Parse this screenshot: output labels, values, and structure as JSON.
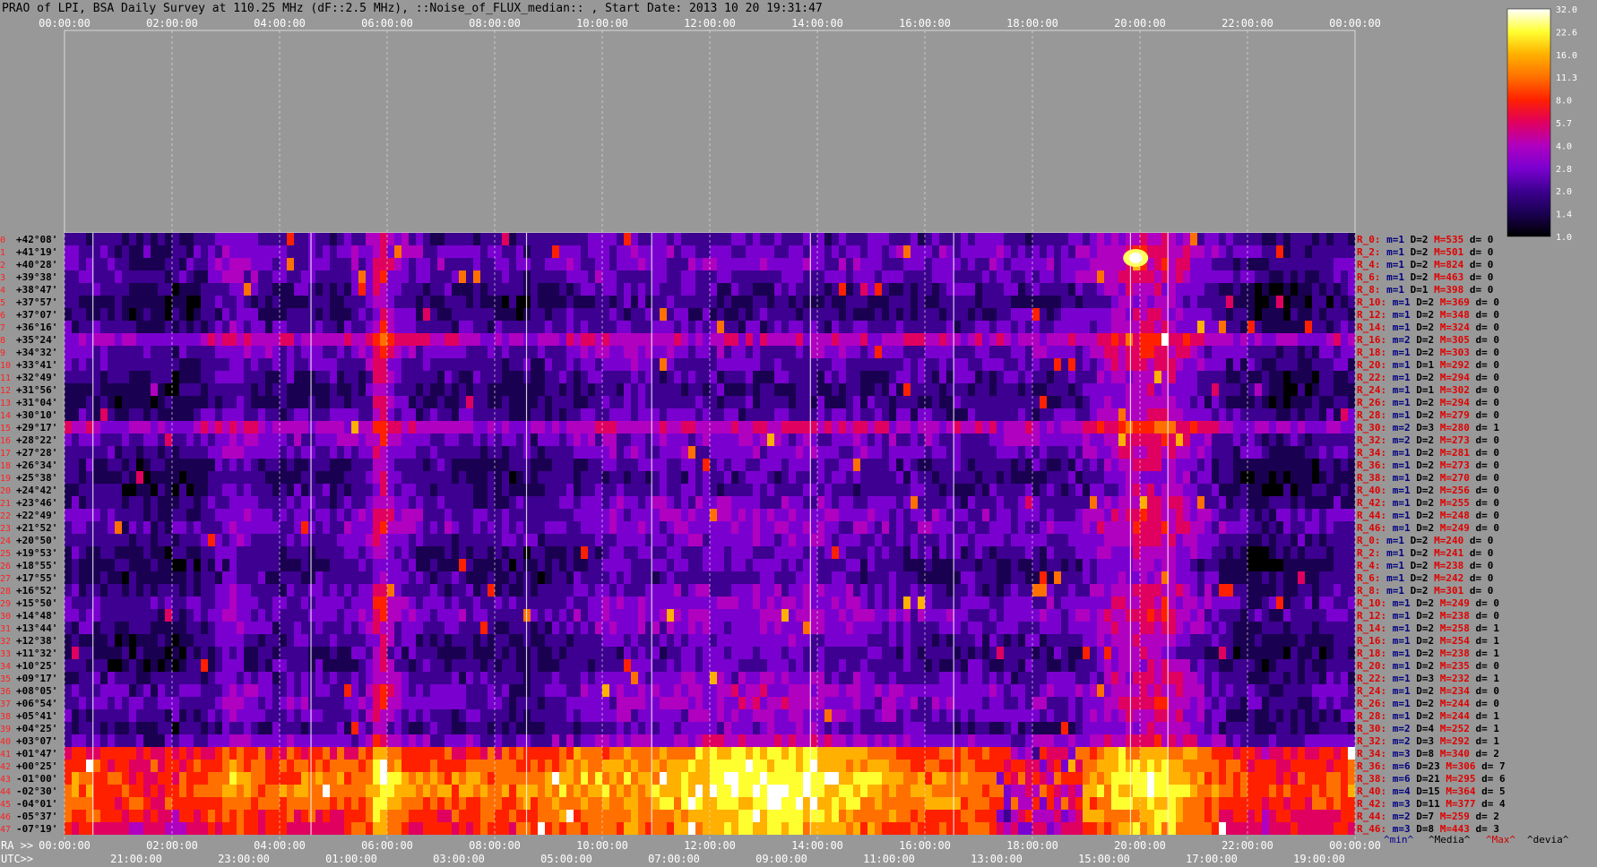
{
  "header": {
    "title": "PRAO of LPI, BSA Daily Survey at 110.25 MHz (dF::2.5 MHz), ::Noise_of_FLUX_median:: , Start Date: 2013 10 20 19:31:47"
  },
  "axes": {
    "top_ticks": [
      "00:00:00",
      "02:00:00",
      "04:00:00",
      "06:00:00",
      "08:00:00",
      "10:00:00",
      "12:00:00",
      "14:00:00",
      "16:00:00",
      "18:00:00",
      "20:00:00",
      "22:00:00",
      "00:00:00"
    ],
    "ra_prefix": "RA >>",
    "ra_ticks": [
      "00:00:00",
      "02:00:00",
      "04:00:00",
      "06:00:00",
      "08:00:00",
      "10:00:00",
      "12:00:00",
      "14:00:00",
      "16:00:00",
      "18:00:00",
      "20:00:00",
      "22:00:00",
      "00:00:00"
    ],
    "utc_prefix": "UTC>>",
    "utc_ticks": [
      "21:00:00",
      "23:00:00",
      "01:00:00",
      "03:00:00",
      "05:00:00",
      "07:00:00",
      "09:00:00",
      "11:00:00",
      "13:00:00",
      "15:00:00",
      "17:00:00",
      "19:00:00"
    ]
  },
  "colorbar": {
    "ticks": [
      "32.0",
      "22.6",
      "16.0",
      "11.3",
      "8.0",
      "5.7",
      "4.0",
      "2.8",
      "2.0",
      "1.4",
      "1.0"
    ],
    "colors": [
      "#000000",
      "#1a0050",
      "#3d0090",
      "#7a00d0",
      "#b000c0",
      "#e00060",
      "#ff2000",
      "#ff7000",
      "#ffb000",
      "#ffff30",
      "#ffffff"
    ]
  },
  "declinations": [
    "+42°08'",
    "+41°19'",
    "+40°28'",
    "+39°38'",
    "+38°47'",
    "+37°57'",
    "+37°07'",
    "+36°16'",
    "+35°24'",
    "+34°32'",
    "+33°41'",
    "+32°49'",
    "+31°56'",
    "+31°04'",
    "+30°10'",
    "+29°17'",
    "+28°22'",
    "+27°28'",
    "+26°34'",
    "+25°38'",
    "+24°42'",
    "+23°46'",
    "+22°49'",
    "+21°52'",
    "+20°50'",
    "+19°53'",
    "+18°55'",
    "+17°55'",
    "+16°52'",
    "+15°50'",
    "+14°48'",
    "+13°44'",
    "+12°38'",
    "+11°32'",
    "+10°25'",
    "+09°17'",
    "+08°05'",
    "+06°54'",
    "+05°41'",
    "+04°25'",
    "+03°07'",
    "+01°47'",
    "+00°25'",
    "-01°00'",
    "-02°30'",
    "-04°01'",
    "-05°37'",
    "-07°19'"
  ],
  "row_stats": [
    {
      "r": "R_0:",
      "m": "m=1",
      "d": "D=2",
      "M": "M=535",
      "dev": "d= 0"
    },
    {
      "r": "R_2:",
      "m": "m=1",
      "d": "D=2",
      "M": "M=501",
      "dev": "d= 0"
    },
    {
      "r": "R_4:",
      "m": "m=1",
      "d": "D=2",
      "M": "M=824",
      "dev": "d= 0"
    },
    {
      "r": "R_6:",
      "m": "m=1",
      "d": "D=2",
      "M": "M=463",
      "dev": "d= 0"
    },
    {
      "r": "R_8:",
      "m": "m=1",
      "d": "D=1",
      "M": "M=398",
      "dev": "d= 0"
    },
    {
      "r": "R_10:",
      "m": "m=1",
      "d": "D=2",
      "M": "M=369",
      "dev": "d= 0"
    },
    {
      "r": "R_12:",
      "m": "m=1",
      "d": "D=2",
      "M": "M=348",
      "dev": "d= 0"
    },
    {
      "r": "R_14:",
      "m": "m=1",
      "d": "D=2",
      "M": "M=324",
      "dev": "d= 0"
    },
    {
      "r": "R_16:",
      "m": "m=2",
      "d": "D=2",
      "M": "M=305",
      "dev": "d= 0"
    },
    {
      "r": "R_18:",
      "m": "m=1",
      "d": "D=2",
      "M": "M=303",
      "dev": "d= 0"
    },
    {
      "r": "R_20:",
      "m": "m=1",
      "d": "D=1",
      "M": "M=292",
      "dev": "d= 0"
    },
    {
      "r": "R_22:",
      "m": "m=1",
      "d": "D=2",
      "M": "M=294",
      "dev": "d= 0"
    },
    {
      "r": "R_24:",
      "m": "m=1",
      "d": "D=1",
      "M": "M=302",
      "dev": "d= 0"
    },
    {
      "r": "R_26:",
      "m": "m=1",
      "d": "D=2",
      "M": "M=294",
      "dev": "d= 0"
    },
    {
      "r": "R_28:",
      "m": "m=1",
      "d": "D=2",
      "M": "M=279",
      "dev": "d= 0"
    },
    {
      "r": "R_30:",
      "m": "m=2",
      "d": "D=3",
      "M": "M=280",
      "dev": "d= 1"
    },
    {
      "r": "R_32:",
      "m": "m=2",
      "d": "D=2",
      "M": "M=273",
      "dev": "d= 0"
    },
    {
      "r": "R_34:",
      "m": "m=1",
      "d": "D=2",
      "M": "M=281",
      "dev": "d= 0"
    },
    {
      "r": "R_36:",
      "m": "m=1",
      "d": "D=2",
      "M": "M=273",
      "dev": "d= 0"
    },
    {
      "r": "R_38:",
      "m": "m=1",
      "d": "D=2",
      "M": "M=270",
      "dev": "d= 0"
    },
    {
      "r": "R_40:",
      "m": "m=1",
      "d": "D=2",
      "M": "M=256",
      "dev": "d= 0"
    },
    {
      "r": "R_42:",
      "m": "m=1",
      "d": "D=2",
      "M": "M=255",
      "dev": "d= 0"
    },
    {
      "r": "R_44:",
      "m": "m=1",
      "d": "D=2",
      "M": "M=248",
      "dev": "d= 0"
    },
    {
      "r": "R_46:",
      "m": "m=1",
      "d": "D=2",
      "M": "M=249",
      "dev": "d= 0"
    },
    {
      "r": "R_0:",
      "m": "m=1",
      "d": "D=2",
      "M": "M=240",
      "dev": "d= 0"
    },
    {
      "r": "R_2:",
      "m": "m=1",
      "d": "D=2",
      "M": "M=241",
      "dev": "d= 0"
    },
    {
      "r": "R_4:",
      "m": "m=1",
      "d": "D=2",
      "M": "M=238",
      "dev": "d= 0"
    },
    {
      "r": "R_6:",
      "m": "m=1",
      "d": "D=2",
      "M": "M=242",
      "dev": "d= 0"
    },
    {
      "r": "R_8:",
      "m": "m=1",
      "d": "D=2",
      "M": "M=301",
      "dev": "d= 0"
    },
    {
      "r": "R_10:",
      "m": "m=1",
      "d": "D=2",
      "M": "M=249",
      "dev": "d= 0"
    },
    {
      "r": "R_12:",
      "m": "m=1",
      "d": "D=2",
      "M": "M=238",
      "dev": "d= 0"
    },
    {
      "r": "R_14:",
      "m": "m=1",
      "d": "D=2",
      "M": "M=258",
      "dev": "d= 1"
    },
    {
      "r": "R_16:",
      "m": "m=1",
      "d": "D=2",
      "M": "M=254",
      "dev": "d= 1"
    },
    {
      "r": "R_18:",
      "m": "m=1",
      "d": "D=2",
      "M": "M=238",
      "dev": "d= 1"
    },
    {
      "r": "R_20:",
      "m": "m=1",
      "d": "D=2",
      "M": "M=235",
      "dev": "d= 0"
    },
    {
      "r": "R_22:",
      "m": "m=1",
      "d": "D=3",
      "M": "M=232",
      "dev": "d= 1"
    },
    {
      "r": "R_24:",
      "m": "m=1",
      "d": "D=2",
      "M": "M=234",
      "dev": "d= 0"
    },
    {
      "r": "R_26:",
      "m": "m=1",
      "d": "D=2",
      "M": "M=244",
      "dev": "d= 0"
    },
    {
      "r": "R_28:",
      "m": "m=1",
      "d": "D=2",
      "M": "M=244",
      "dev": "d= 1"
    },
    {
      "r": "R_30:",
      "m": "m=2",
      "d": "D=4",
      "M": "M=252",
      "dev": "d= 1"
    },
    {
      "r": "R_32:",
      "m": "m=2",
      "d": "D=3",
      "M": "M=292",
      "dev": "d= 1"
    },
    {
      "r": "R_34:",
      "m": "m=3",
      "d": "D=8",
      "M": "M=340",
      "dev": "d= 2"
    },
    {
      "r": "R_36:",
      "m": "m=6",
      "d": "D=23",
      "M": "M=306",
      "dev": "d= 7"
    },
    {
      "r": "R_38:",
      "m": "m=6",
      "d": "D=21",
      "M": "M=295",
      "dev": "d= 6"
    },
    {
      "r": "R_40:",
      "m": "m=4",
      "d": "D=15",
      "M": "M=364",
      "dev": "d= 5"
    },
    {
      "r": "R_42:",
      "m": "m=3",
      "d": "D=11",
      "M": "M=377",
      "dev": "d= 4"
    },
    {
      "r": "R_44:",
      "m": "m=2",
      "d": "D=7",
      "M": "M=259",
      "dev": "d= 2"
    },
    {
      "r": "R_46:",
      "m": "m=3",
      "d": "D=8",
      "M": "M=443",
      "dev": "d= 3"
    }
  ],
  "stats_legend": {
    "min": "^min^",
    "median": "^Media^",
    "max": "^Max^",
    "dev": "^devia^"
  },
  "chart_data": {
    "type": "heatmap",
    "title": "PRAO of LPI, BSA Daily Survey at 110.25 MHz (dF::2.5 MHz), ::Noise_of_FLUX_median:: , Start Date: 2013 10 20 19:31:47",
    "xlabel": "RA",
    "x_range": [
      "00:00:00",
      "00:00:00"
    ],
    "y_rows": 48,
    "colorscale_range": [
      1.0,
      32.0
    ],
    "colorscale_log": true,
    "hot_regions": [
      {
        "ra": "00:00-24:00",
        "rows": "41-47",
        "level": "very high"
      },
      {
        "ra": "19:30-21:00",
        "rows": "all",
        "level": "high"
      },
      {
        "ra": "12:00-15:00",
        "rows": "15-40",
        "level": "high"
      },
      {
        "ra": "20:00",
        "rows": "0-4",
        "level": "very high"
      },
      {
        "ra": "06:00",
        "rows": "all",
        "level": "high"
      }
    ],
    "grid": true
  }
}
